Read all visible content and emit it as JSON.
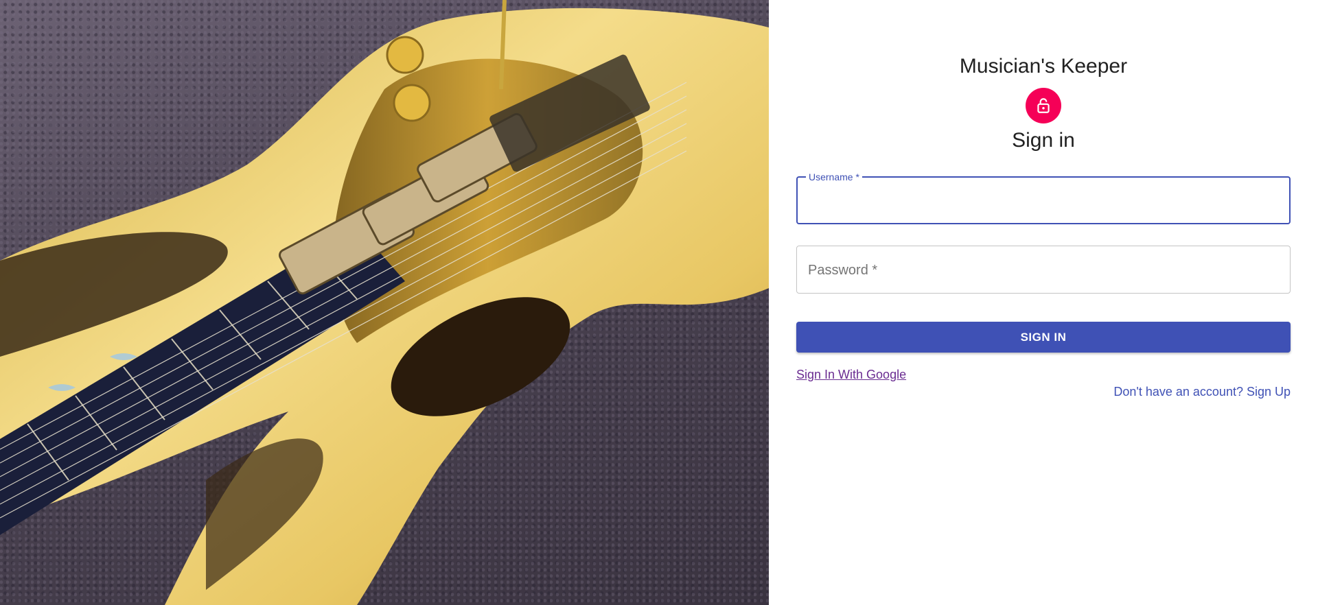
{
  "app": {
    "title": "Musician's Keeper"
  },
  "signin": {
    "heading": "Sign in",
    "username_label": "Username *",
    "username_value": "",
    "password_label": "Password *",
    "password_value": "",
    "submit_label": "SIGN IN",
    "google_link": "Sign In With Google",
    "signup_link": "Don't have an account? Sign Up"
  },
  "icons": {
    "avatar": "lock-icon"
  },
  "colors": {
    "primary": "#3f51b5",
    "avatar": "#f50057",
    "google_link": "#6a2c91"
  }
}
